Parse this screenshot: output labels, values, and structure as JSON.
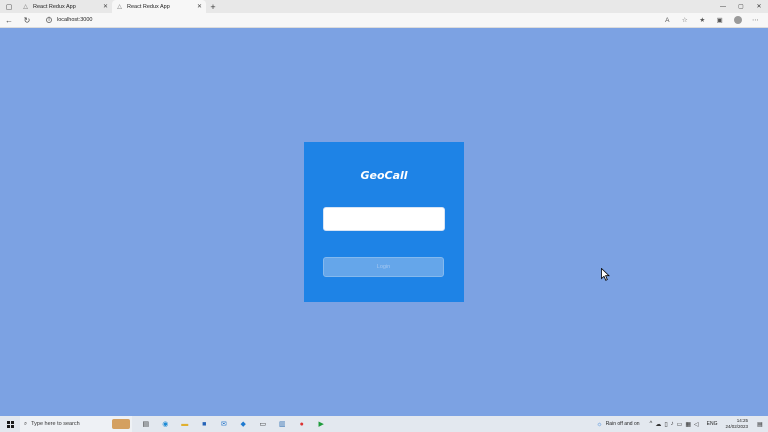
{
  "browser": {
    "tabs": [
      {
        "label": "React Redux App",
        "active": false
      },
      {
        "label": "React Redux App",
        "active": true
      }
    ],
    "new_tab": "+",
    "address": "localhost:3000"
  },
  "app": {
    "title": "GeoCall",
    "input_value": "",
    "button_label": "Login"
  },
  "taskbar": {
    "search_placeholder": "Type here to search",
    "weather_text": "Rain off and on",
    "lang": "ENG",
    "time": "14:25",
    "date": "24/02/2023"
  },
  "colors": {
    "page_bg": "#7ca2e3",
    "card_bg": "#1e83e6",
    "button_bg": "#65a6ea"
  },
  "icons": {
    "tab_favicon": "react-triangle-icon",
    "weather": "sun-cloud-icon"
  }
}
